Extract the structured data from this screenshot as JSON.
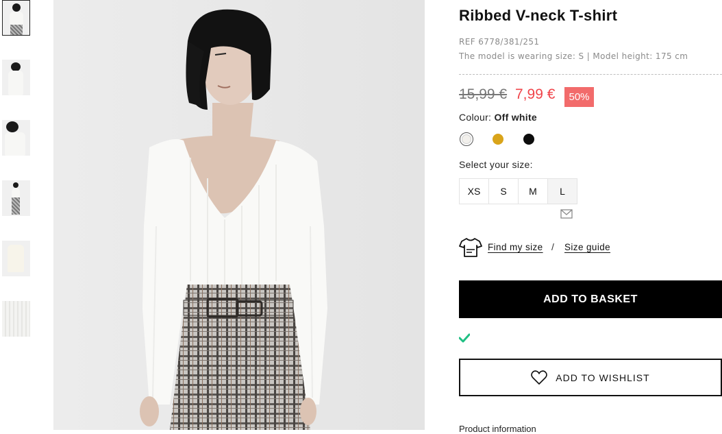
{
  "thumbnails": [
    {
      "name": "thumbnail-front-view",
      "active": true
    },
    {
      "name": "thumbnail-back-view",
      "active": false
    },
    {
      "name": "thumbnail-side-view",
      "active": false
    },
    {
      "name": "thumbnail-full-body",
      "active": false
    },
    {
      "name": "thumbnail-flat-garment",
      "active": false
    },
    {
      "name": "thumbnail-fabric-detail",
      "active": false
    }
  ],
  "product": {
    "title": "Ribbed V-neck T-shirt",
    "ref": "REF 6778/381/251",
    "model_info": "The model is wearing size: S | Model height: 175 cm",
    "old_price": "15,99 €",
    "new_price": "7,99 €",
    "discount": "50%"
  },
  "colour": {
    "label": "Colour:",
    "selected": "Off white",
    "swatches": [
      {
        "name": "off-white",
        "hex": "#f2f0ec",
        "selected": true
      },
      {
        "name": "mustard",
        "hex": "#d9a41a",
        "selected": false
      },
      {
        "name": "black",
        "hex": "#0d0d0d",
        "selected": false
      }
    ]
  },
  "size": {
    "label": "Select your size:",
    "options": [
      {
        "label": "XS",
        "available": true
      },
      {
        "label": "S",
        "available": true
      },
      {
        "label": "M",
        "available": true
      },
      {
        "label": "L",
        "available": false
      }
    ],
    "notify_icon": "envelope-icon"
  },
  "links": {
    "find_my_size": "Find my size",
    "separator": "/",
    "size_guide": "Size guide"
  },
  "actions": {
    "add_to_basket": "ADD TO BASKET",
    "add_to_wishlist": "ADD TO WISHLIST"
  },
  "status": {
    "check_icon": "check-icon"
  },
  "sections": {
    "product_information": "Product information"
  },
  "colors": {
    "sale_red": "#f0444a",
    "badge_red": "#f26b6b",
    "check_green": "#1fbf83",
    "button_black": "#000000"
  }
}
